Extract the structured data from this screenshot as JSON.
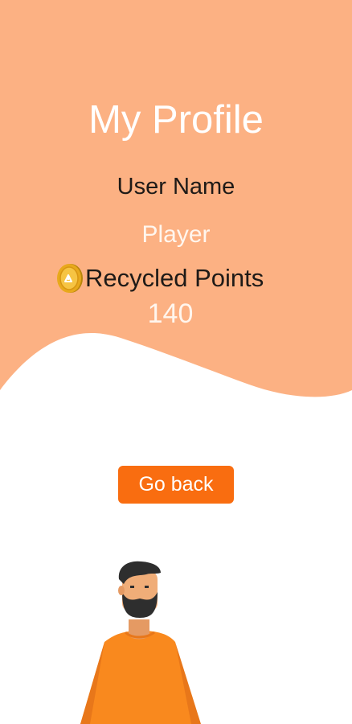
{
  "header": {
    "title": "My Profile"
  },
  "profile": {
    "username_label": "User Name",
    "username_value": "Player",
    "points_label": "Recycled Points",
    "points_value": "140",
    "points_icon": "recycle-coin-icon"
  },
  "actions": {
    "go_back_label": "Go back"
  },
  "colors": {
    "header_background": "#fcb183",
    "button_background": "#f96d10",
    "character_shirt": "#f9891e",
    "character_hair": "#2e2e2e"
  }
}
